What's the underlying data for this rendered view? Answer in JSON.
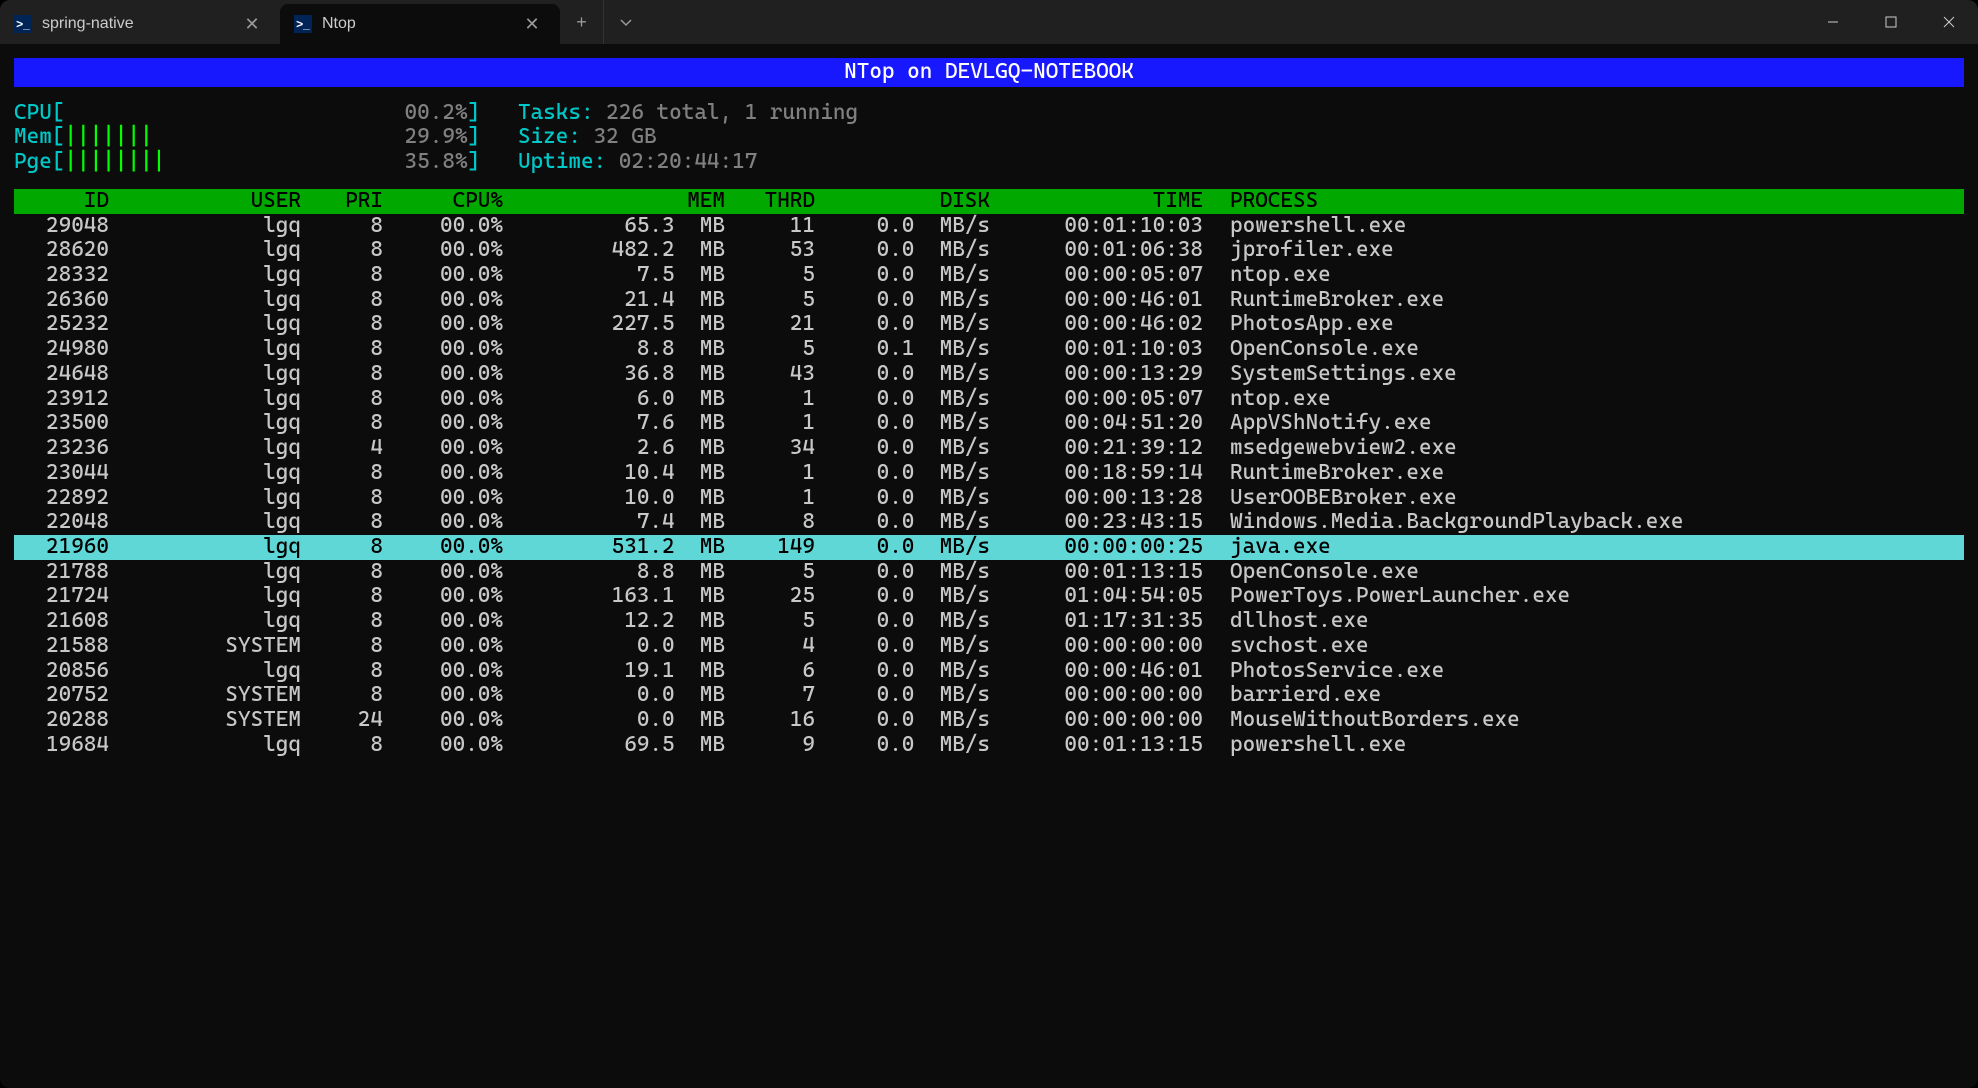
{
  "window": {
    "tabs": [
      {
        "title": "spring-native",
        "active": false
      },
      {
        "title": "Ntop",
        "active": true
      }
    ]
  },
  "banner": "NTop on DEVLGQ-NOTEBOOK",
  "stats": {
    "cpu": {
      "label": "CPU",
      "bars": "",
      "pct": "00.2%"
    },
    "mem": {
      "label": "Mem",
      "bars": "|||||||",
      "pct": "29.9%"
    },
    "pge": {
      "label": "Pge",
      "bars": "||||||||",
      "pct": "35.8%"
    },
    "tasks_label": "Tasks:",
    "tasks_value": "226 total, 1 running",
    "size_label": "Size:",
    "size_value": "32 GB",
    "uptime_label": "Uptime:",
    "uptime_value": "02:20:44:17"
  },
  "columns": {
    "id": "ID",
    "user": "USER",
    "pri": "PRI",
    "cpu": "CPU%",
    "mem": "MEM",
    "thrd": "THRD",
    "disk": "DISK",
    "time": "TIME",
    "process": "PROCESS"
  },
  "processes": [
    {
      "id": "29048",
      "user": "lgq",
      "pri": "8",
      "cpu": "00.0%",
      "mem": "65.3  MB",
      "thrd": "11",
      "disk": "0.0  MB/s",
      "time": "00:01:10:03",
      "process": "powershell.exe",
      "highlighted": false
    },
    {
      "id": "28620",
      "user": "lgq",
      "pri": "8",
      "cpu": "00.0%",
      "mem": "482.2  MB",
      "thrd": "53",
      "disk": "0.0  MB/s",
      "time": "00:01:06:38",
      "process": "jprofiler.exe",
      "highlighted": false
    },
    {
      "id": "28332",
      "user": "lgq",
      "pri": "8",
      "cpu": "00.0%",
      "mem": "7.5  MB",
      "thrd": "5",
      "disk": "0.0  MB/s",
      "time": "00:00:05:07",
      "process": "ntop.exe",
      "highlighted": false
    },
    {
      "id": "26360",
      "user": "lgq",
      "pri": "8",
      "cpu": "00.0%",
      "mem": "21.4  MB",
      "thrd": "5",
      "disk": "0.0  MB/s",
      "time": "00:00:46:01",
      "process": "RuntimeBroker.exe",
      "highlighted": false
    },
    {
      "id": "25232",
      "user": "lgq",
      "pri": "8",
      "cpu": "00.0%",
      "mem": "227.5  MB",
      "thrd": "21",
      "disk": "0.0  MB/s",
      "time": "00:00:46:02",
      "process": "PhotosApp.exe",
      "highlighted": false
    },
    {
      "id": "24980",
      "user": "lgq",
      "pri": "8",
      "cpu": "00.0%",
      "mem": "8.8  MB",
      "thrd": "5",
      "disk": "0.1  MB/s",
      "time": "00:01:10:03",
      "process": "OpenConsole.exe",
      "highlighted": false
    },
    {
      "id": "24648",
      "user": "lgq",
      "pri": "8",
      "cpu": "00.0%",
      "mem": "36.8  MB",
      "thrd": "43",
      "disk": "0.0  MB/s",
      "time": "00:00:13:29",
      "process": "SystemSettings.exe",
      "highlighted": false
    },
    {
      "id": "23912",
      "user": "lgq",
      "pri": "8",
      "cpu": "00.0%",
      "mem": "6.0  MB",
      "thrd": "1",
      "disk": "0.0  MB/s",
      "time": "00:00:05:07",
      "process": "ntop.exe",
      "highlighted": false
    },
    {
      "id": "23500",
      "user": "lgq",
      "pri": "8",
      "cpu": "00.0%",
      "mem": "7.6  MB",
      "thrd": "1",
      "disk": "0.0  MB/s",
      "time": "00:04:51:20",
      "process": "AppVShNotify.exe",
      "highlighted": false
    },
    {
      "id": "23236",
      "user": "lgq",
      "pri": "4",
      "cpu": "00.0%",
      "mem": "2.6  MB",
      "thrd": "34",
      "disk": "0.0  MB/s",
      "time": "00:21:39:12",
      "process": "msedgewebview2.exe",
      "highlighted": false
    },
    {
      "id": "23044",
      "user": "lgq",
      "pri": "8",
      "cpu": "00.0%",
      "mem": "10.4  MB",
      "thrd": "1",
      "disk": "0.0  MB/s",
      "time": "00:18:59:14",
      "process": "RuntimeBroker.exe",
      "highlighted": false
    },
    {
      "id": "22892",
      "user": "lgq",
      "pri": "8",
      "cpu": "00.0%",
      "mem": "10.0  MB",
      "thrd": "1",
      "disk": "0.0  MB/s",
      "time": "00:00:13:28",
      "process": "UserOOBEBroker.exe",
      "highlighted": false
    },
    {
      "id": "22048",
      "user": "lgq",
      "pri": "8",
      "cpu": "00.0%",
      "mem": "7.4  MB",
      "thrd": "8",
      "disk": "0.0  MB/s",
      "time": "00:23:43:15",
      "process": "Windows.Media.BackgroundPlayback.exe",
      "highlighted": false
    },
    {
      "id": "21960",
      "user": "lgq",
      "pri": "8",
      "cpu": "00.0%",
      "mem": "531.2  MB",
      "thrd": "149",
      "disk": "0.0  MB/s",
      "time": "00:00:00:25",
      "process": "java.exe",
      "highlighted": true
    },
    {
      "id": "21788",
      "user": "lgq",
      "pri": "8",
      "cpu": "00.0%",
      "mem": "8.8  MB",
      "thrd": "5",
      "disk": "0.0  MB/s",
      "time": "00:01:13:15",
      "process": "OpenConsole.exe",
      "highlighted": false
    },
    {
      "id": "21724",
      "user": "lgq",
      "pri": "8",
      "cpu": "00.0%",
      "mem": "163.1  MB",
      "thrd": "25",
      "disk": "0.0  MB/s",
      "time": "01:04:54:05",
      "process": "PowerToys.PowerLauncher.exe",
      "highlighted": false
    },
    {
      "id": "21608",
      "user": "lgq",
      "pri": "8",
      "cpu": "00.0%",
      "mem": "12.2  MB",
      "thrd": "5",
      "disk": "0.0  MB/s",
      "time": "01:17:31:35",
      "process": "dllhost.exe",
      "highlighted": false
    },
    {
      "id": "21588",
      "user": "SYSTEM",
      "pri": "8",
      "cpu": "00.0%",
      "mem": "0.0  MB",
      "thrd": "4",
      "disk": "0.0  MB/s",
      "time": "00:00:00:00",
      "process": "svchost.exe",
      "highlighted": false
    },
    {
      "id": "20856",
      "user": "lgq",
      "pri": "8",
      "cpu": "00.0%",
      "mem": "19.1  MB",
      "thrd": "6",
      "disk": "0.0  MB/s",
      "time": "00:00:46:01",
      "process": "PhotosService.exe",
      "highlighted": false
    },
    {
      "id": "20752",
      "user": "SYSTEM",
      "pri": "8",
      "cpu": "00.0%",
      "mem": "0.0  MB",
      "thrd": "7",
      "disk": "0.0  MB/s",
      "time": "00:00:00:00",
      "process": "barrierd.exe",
      "highlighted": false
    },
    {
      "id": "20288",
      "user": "SYSTEM",
      "pri": "24",
      "cpu": "00.0%",
      "mem": "0.0  MB",
      "thrd": "16",
      "disk": "0.0  MB/s",
      "time": "00:00:00:00",
      "process": "MouseWithoutBorders.exe",
      "highlighted": false
    },
    {
      "id": "19684",
      "user": "lgq",
      "pri": "8",
      "cpu": "00.0%",
      "mem": "69.5  MB",
      "thrd": "9",
      "disk": "0.0  MB/s",
      "time": "00:01:13:15",
      "process": "powershell.exe",
      "highlighted": false
    }
  ]
}
